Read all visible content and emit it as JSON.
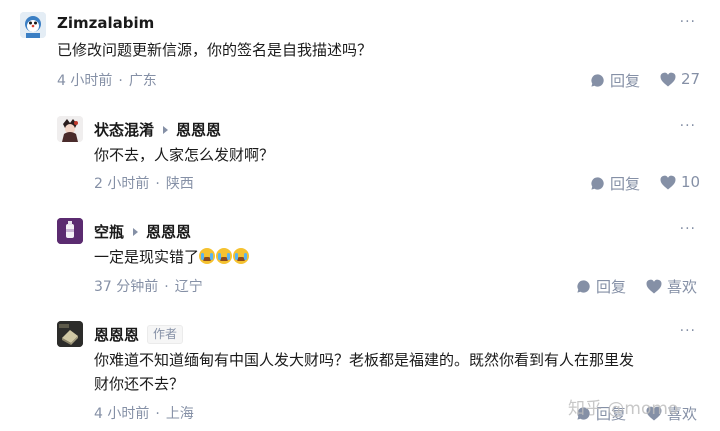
{
  "comments": [
    {
      "username": "Zimzalabim",
      "content": "已修改问题更新信源，你的签名是自我描述吗？",
      "time": "4 小时前",
      "location": "广东",
      "reply_label": "回复",
      "likes": "27"
    },
    {
      "username": "状态混淆",
      "reply_to": "恩恩恩",
      "content": "你不去，人家怎么发财啊？",
      "time": "2 小时前",
      "location": "陕西",
      "reply_label": "回复",
      "likes": "10"
    },
    {
      "username": "空瓶",
      "reply_to": "恩恩恩",
      "content": "一定是现实错了",
      "emoji_name": "crying-emoji",
      "time": "37 分钟前",
      "location": "辽宁",
      "reply_label": "回复",
      "like_label": "喜欢"
    },
    {
      "username": "恩恩恩",
      "author_tag": "作者",
      "content_line1": "你难道不知道缅甸有中国人发大财吗？老板都是福建的。既然你看到有人在那里发",
      "content_line2": "财你还不去？",
      "time": "4 小时前",
      "location": "上海",
      "reply_label": "回复",
      "like_label": "喜欢"
    }
  ],
  "more_glyph": "···",
  "separator": "·",
  "watermark": "知乎 @momo",
  "colors": {
    "meta": "#8590a6",
    "text": "#1a1a1a"
  }
}
